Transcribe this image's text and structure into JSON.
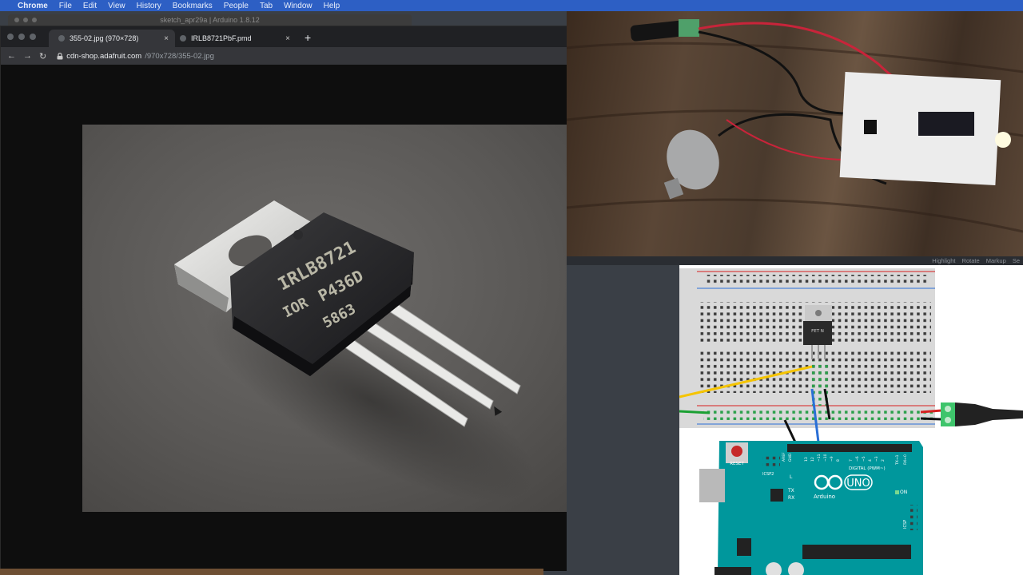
{
  "menubar": {
    "apple_icon": "apple-icon",
    "items": [
      "Chrome",
      "File",
      "Edit",
      "View",
      "History",
      "Bookmarks",
      "People",
      "Tab",
      "Window",
      "Help"
    ]
  },
  "background_window": {
    "title": "sketch_apr29a | Arduino 1.8.12"
  },
  "browser": {
    "tabs": [
      {
        "label": "355-02.jpg (970×728)",
        "active": true
      },
      {
        "label": "IRLB8721PbF.pmd",
        "active": false
      }
    ],
    "new_tab_label": "+",
    "close_label": "×",
    "nav": {
      "back": "←",
      "forward": "→",
      "reload": "↻"
    },
    "url_host": "cdn-shop.adafruit.com",
    "url_path": "/970x728/355-02.jpg"
  },
  "product_image": {
    "part_lines": [
      "IRLB8721",
      "P436D",
      "5863"
    ],
    "logo_text": "IOR"
  },
  "fritzing": {
    "toolbar_items": "Highlight Rotate Markup Se",
    "mosfet_label": "FET N",
    "board": {
      "reset": "RESET",
      "icsp2": "ICSP2",
      "aref": "AREF",
      "gnd": "GND",
      "digital_label": "DIGITAL (PWM~)",
      "tx": "TX",
      "rx": "RX",
      "l": "L",
      "brand": "Arduino",
      "model": "UNO",
      "on": "ON",
      "icsp": "ICSP",
      "pin_numbers": [
        "13",
        "12",
        "~11",
        "~10",
        "~9",
        "8",
        "7",
        "~6",
        "~5",
        "4",
        "~3",
        "2",
        "TX→1",
        "RX←0"
      ]
    }
  },
  "colors": {
    "menubar": "#2d5fc4",
    "tab_bg": "#202124",
    "active_tab": "#35363a",
    "arduino_teal": "#00979c",
    "wire_yellow": "#f5c400",
    "wire_green": "#1aa032",
    "wire_blue": "#2a6fd6",
    "wire_red": "#d62020"
  }
}
